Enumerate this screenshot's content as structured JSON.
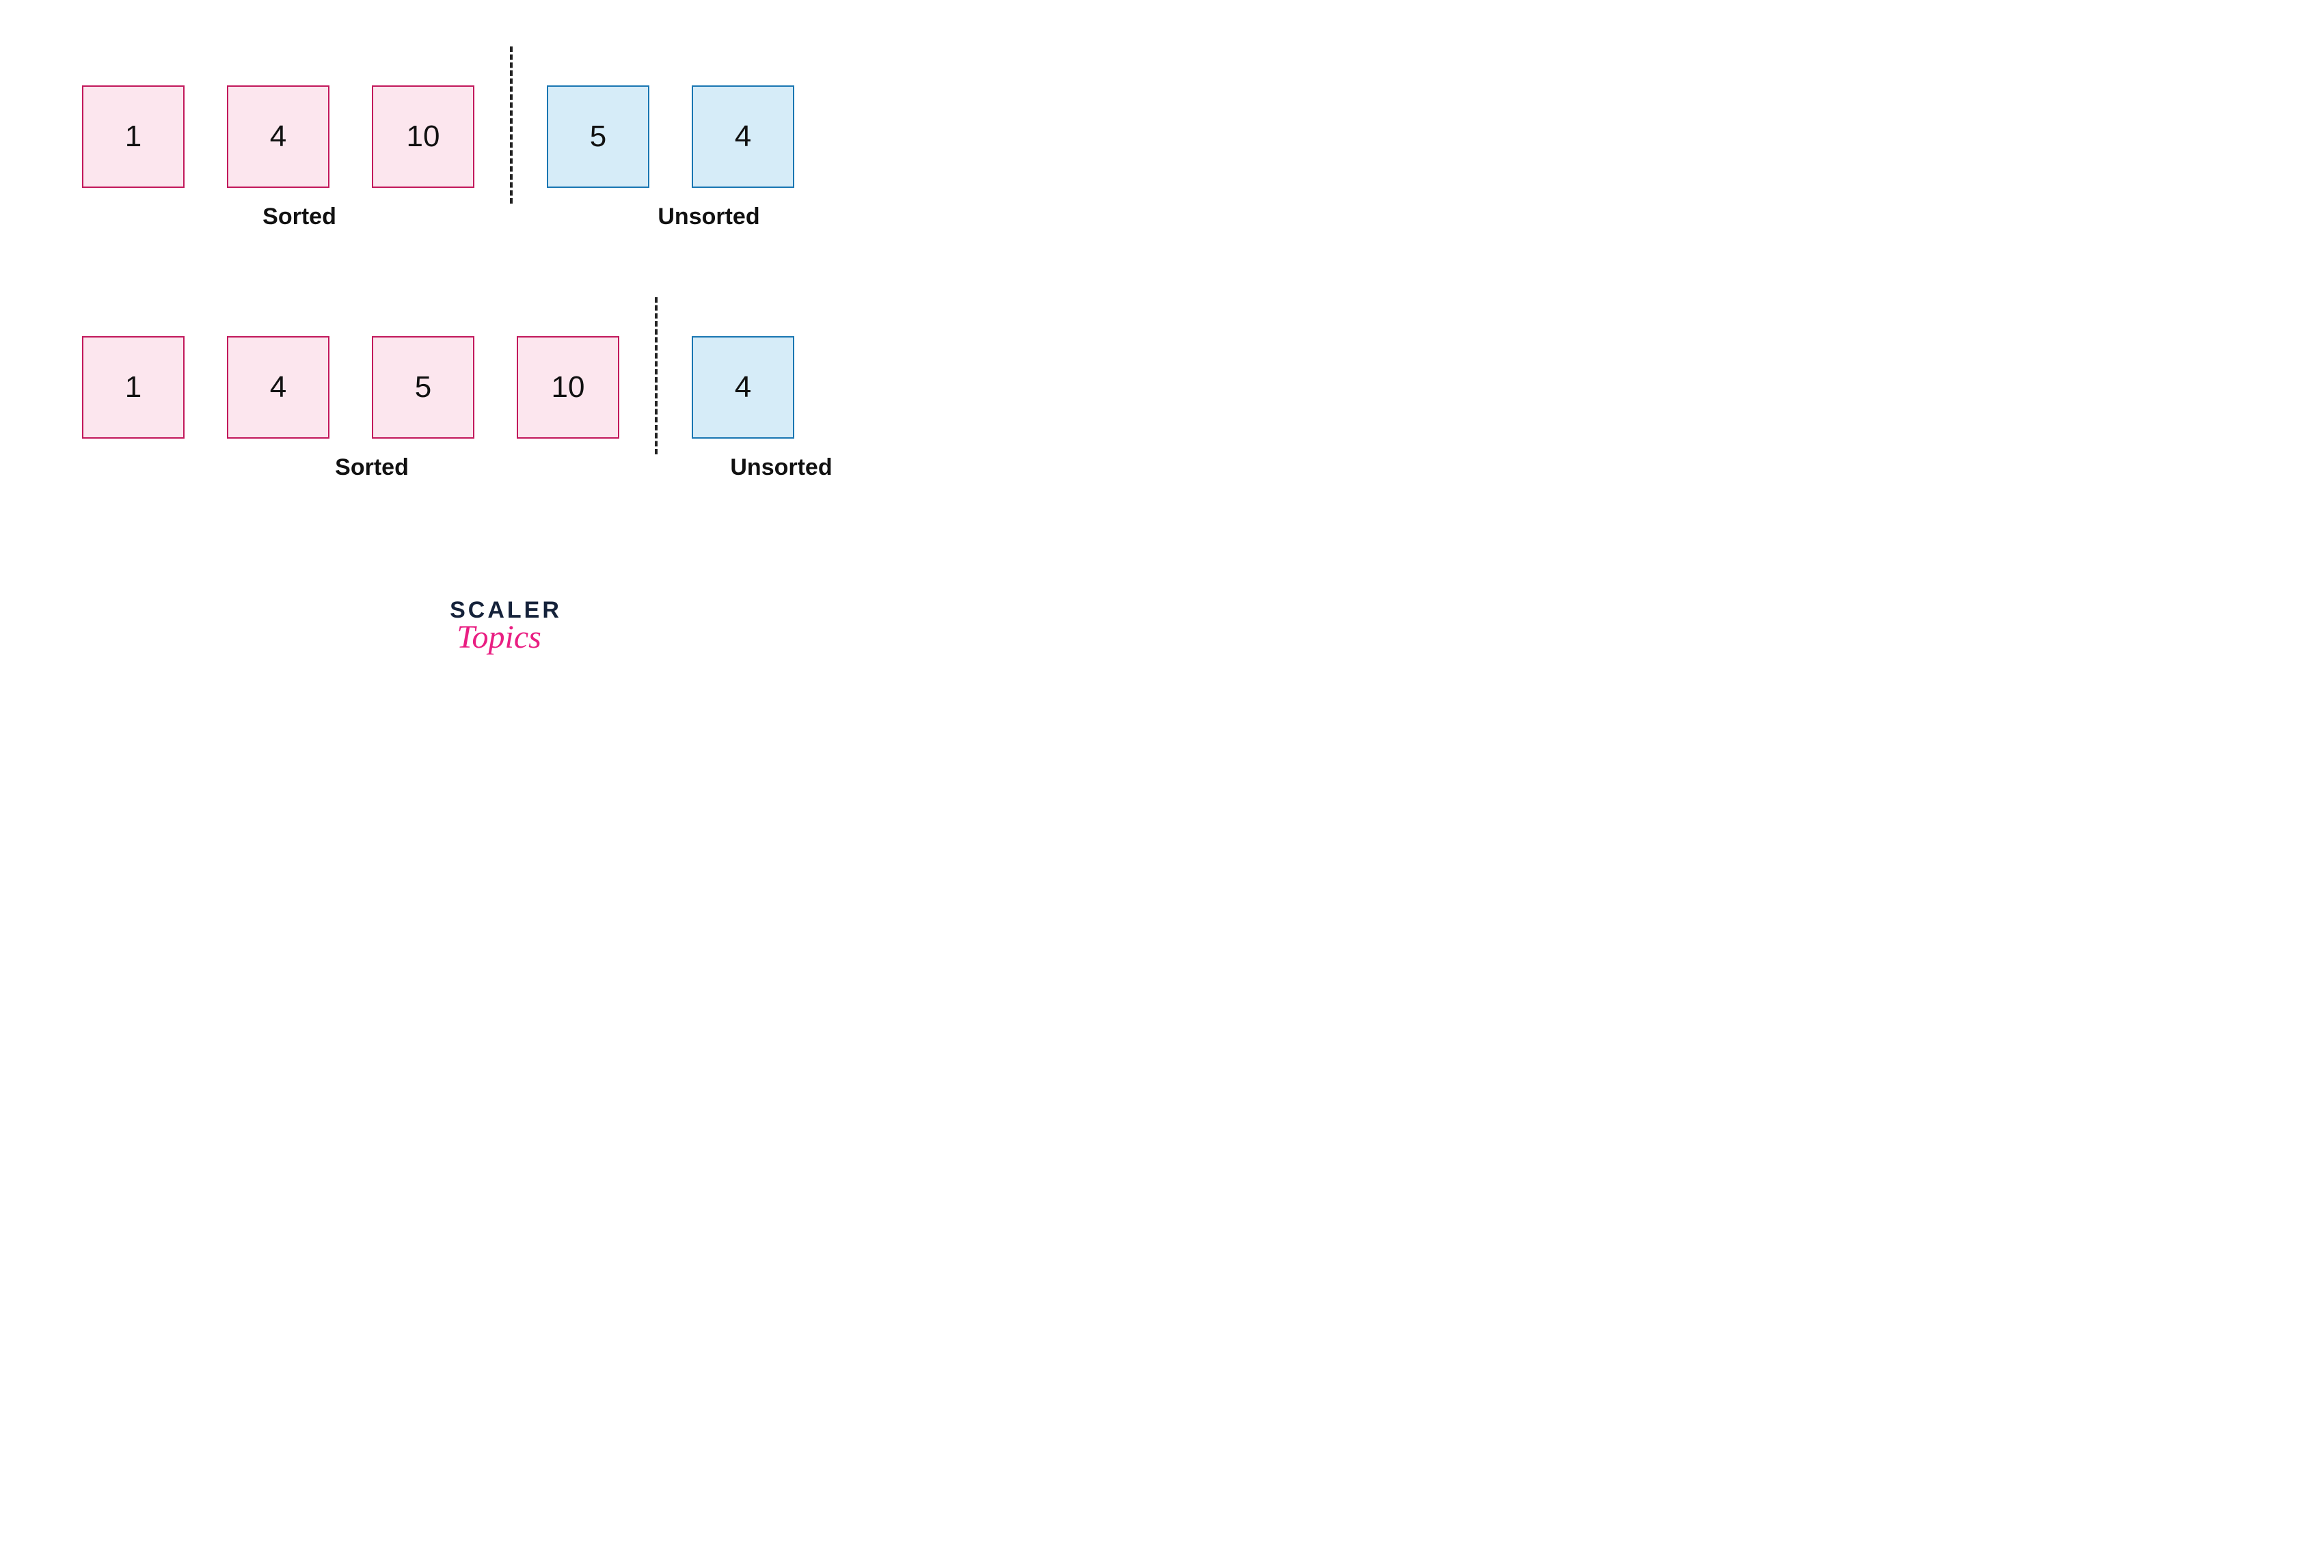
{
  "rows": [
    {
      "sorted": [
        1,
        4,
        10
      ],
      "unsorted": [
        5,
        4
      ],
      "sorted_label": "Sorted",
      "unsorted_label": "Unsorted"
    },
    {
      "sorted": [
        1,
        4,
        5,
        10
      ],
      "unsorted": [
        4
      ],
      "sorted_label": "Sorted",
      "unsorted_label": "Unsorted"
    }
  ],
  "logo": {
    "line1": "SCALER",
    "line2": "Topics"
  },
  "colors": {
    "sorted_fill": "#fce6ee",
    "sorted_border": "#c2185b",
    "unsorted_fill": "#d6ecf8",
    "unsorted_border": "#1976b2"
  }
}
